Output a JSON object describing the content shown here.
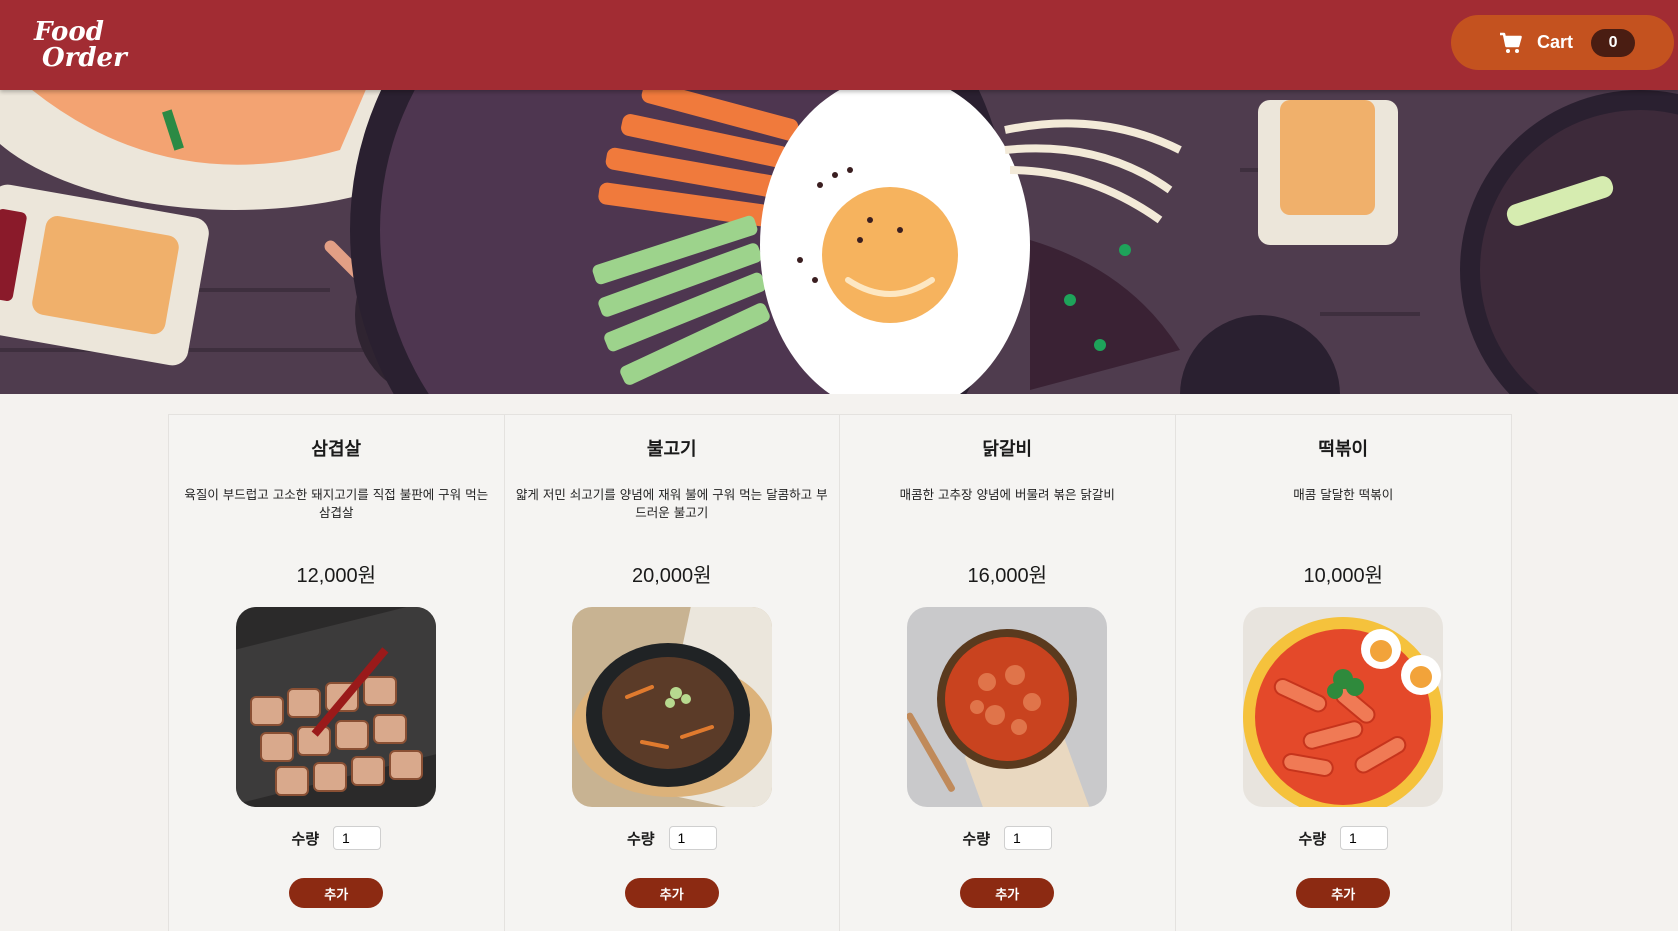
{
  "header": {
    "logo_line1": "Food",
    "logo_line2": "Order",
    "cart": {
      "label": "Cart",
      "count": "0",
      "icon": "cart-icon"
    }
  },
  "colors": {
    "header_bg": "#a22c33",
    "cart_button_bg": "#c4521f",
    "cart_badge_bg": "#4a1d12",
    "add_button_bg": "#8c2a12",
    "page_bg": "#f4f2ef"
  },
  "menu": {
    "qty_label": "수량",
    "add_label": "추가",
    "items": [
      {
        "name": "삼겹살",
        "description": "육질이 부드럽고 고소한 돼지고기를 직접 불판에 구워 먹는 삼겹살",
        "price": "12,000원",
        "quantity": "1",
        "image": "samgyeopsal-photo"
      },
      {
        "name": "불고기",
        "description": "얇게 저민 쇠고기를 양념에 재워 불에 구워 먹는 달콤하고 부드러운 불고기",
        "price": "20,000원",
        "quantity": "1",
        "image": "bulgogi-photo"
      },
      {
        "name": "닭갈비",
        "description": "매콤한 고추장 양념에 버물려 볶은 닭갈비",
        "price": "16,000원",
        "quantity": "1",
        "image": "dakgalbi-photo"
      },
      {
        "name": "떡볶이",
        "description": "매콤 달달한 떡볶이",
        "price": "10,000원",
        "quantity": "1",
        "image": "tteokbokki-photo"
      }
    ]
  }
}
